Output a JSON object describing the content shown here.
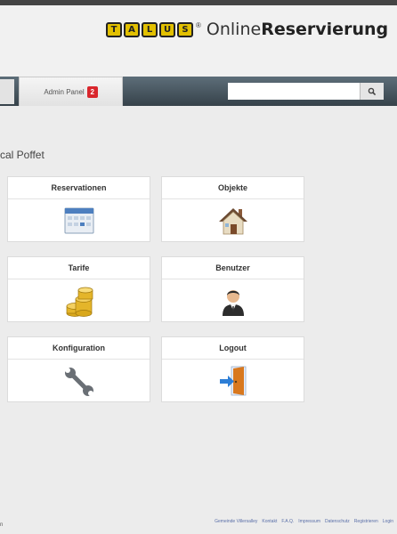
{
  "brand": {
    "logo_letters": [
      "T",
      "A",
      "L",
      "U",
      "S"
    ],
    "registered_mark": "®",
    "name_light": "Online",
    "name_bold": "Reservierung"
  },
  "nav": {
    "tab_label": "Admin Panel",
    "badge_count": "2",
    "search": {
      "value": "",
      "placeholder": ""
    }
  },
  "page": {
    "title": "cal Poffet"
  },
  "tiles": [
    {
      "label": "Reservationen",
      "icon": "calendar-icon"
    },
    {
      "label": "Objekte",
      "icon": "house-icon"
    },
    {
      "label": "Tarife",
      "icon": "coins-icon"
    },
    {
      "label": "Benutzer",
      "icon": "user-icon"
    },
    {
      "label": "Konfiguration",
      "icon": "wrench-icon"
    },
    {
      "label": "Logout",
      "icon": "logout-door-icon"
    }
  ],
  "footer": {
    "left_text": "n",
    "links": [
      "Gemeinde Villersalley",
      "Kontakt",
      "F.A.Q.",
      "Impressum",
      "Datenschutz",
      "Registrieren",
      "Login"
    ]
  },
  "colors": {
    "navbar_top": "#5d6e79",
    "navbar_bottom": "#36424a",
    "badge": "#d9262c",
    "logo_yellow": "#e2c000",
    "footer_link": "#5a6fa8"
  }
}
